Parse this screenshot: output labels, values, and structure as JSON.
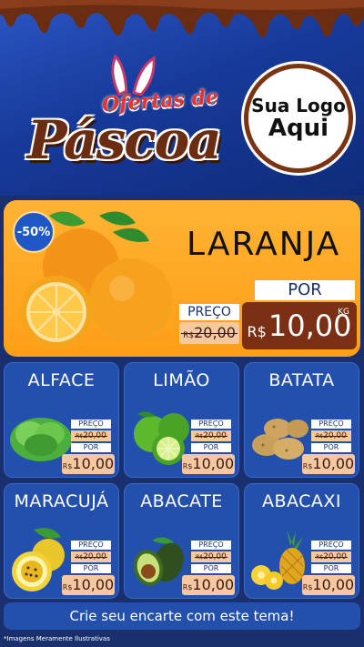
{
  "header": {
    "ofertas_text": "Ofertas de",
    "pascoa_text": "Páscoa",
    "logo_line1": "Sua Logo",
    "logo_line2": "Aqui"
  },
  "hero": {
    "discount_badge": "-50%",
    "product_name": "LARANJA",
    "preco_label": "PREÇO",
    "old_price_prefix": "R$",
    "old_price": "20,00",
    "por_label": "POR",
    "currency": "R$",
    "new_price": "10,00",
    "unit": "KG"
  },
  "products": [
    {
      "name": "ALFACE",
      "preco_label": "PREÇO",
      "old_prefix": "R$",
      "old_price": "20,00",
      "por_label": "POR",
      "currency": "R$",
      "new_price": "10,00"
    },
    {
      "name": "LIMÃO",
      "preco_label": "PREÇO",
      "old_prefix": "R$",
      "old_price": "20,00",
      "por_label": "POR",
      "currency": "R$",
      "new_price": "10,00"
    },
    {
      "name": "BATATA",
      "preco_label": "PREÇO",
      "old_prefix": "R$",
      "old_price": "20,00",
      "por_label": "POR",
      "currency": "R$",
      "new_price": "10,00"
    },
    {
      "name": "MARACUJÁ",
      "preco_label": "PREÇO",
      "old_prefix": "R$",
      "old_price": "20,00",
      "por_label": "POR",
      "currency": "R$",
      "new_price": "10,00"
    },
    {
      "name": "ABACATE",
      "preco_label": "PREÇO",
      "old_prefix": "R$",
      "old_price": "20,00",
      "por_label": "POR",
      "currency": "R$",
      "new_price": "10,00"
    },
    {
      "name": "ABACAXI",
      "preco_label": "PREÇO",
      "old_prefix": "R$",
      "old_price": "20,00",
      "por_label": "POR",
      "currency": "R$",
      "new_price": "10,00"
    }
  ],
  "footer": {
    "cta": "Crie seu encarte com este tema!",
    "disclaimer": "*Imagens Meramente Ilustrativas"
  },
  "colors": {
    "header_blue": "#1f4fb8",
    "chocolate": "#6b2d12",
    "hero_orange": "#ffa21f",
    "cell_blue": "#2350ad",
    "price_brown": "#7b2f14",
    "old_price_peach": "#f6c8a1"
  },
  "icons": {
    "chocolate_drip": "chocolate-drip-icon",
    "bunny_ears": "bunny-ears-icon",
    "orange": "orange-fruit-icon",
    "lettuce": "lettuce-icon",
    "lime": "lime-icon",
    "potato": "potato-icon",
    "passion_fruit": "passion-fruit-icon",
    "avocado": "avocado-icon",
    "pineapple": "pineapple-icon"
  }
}
